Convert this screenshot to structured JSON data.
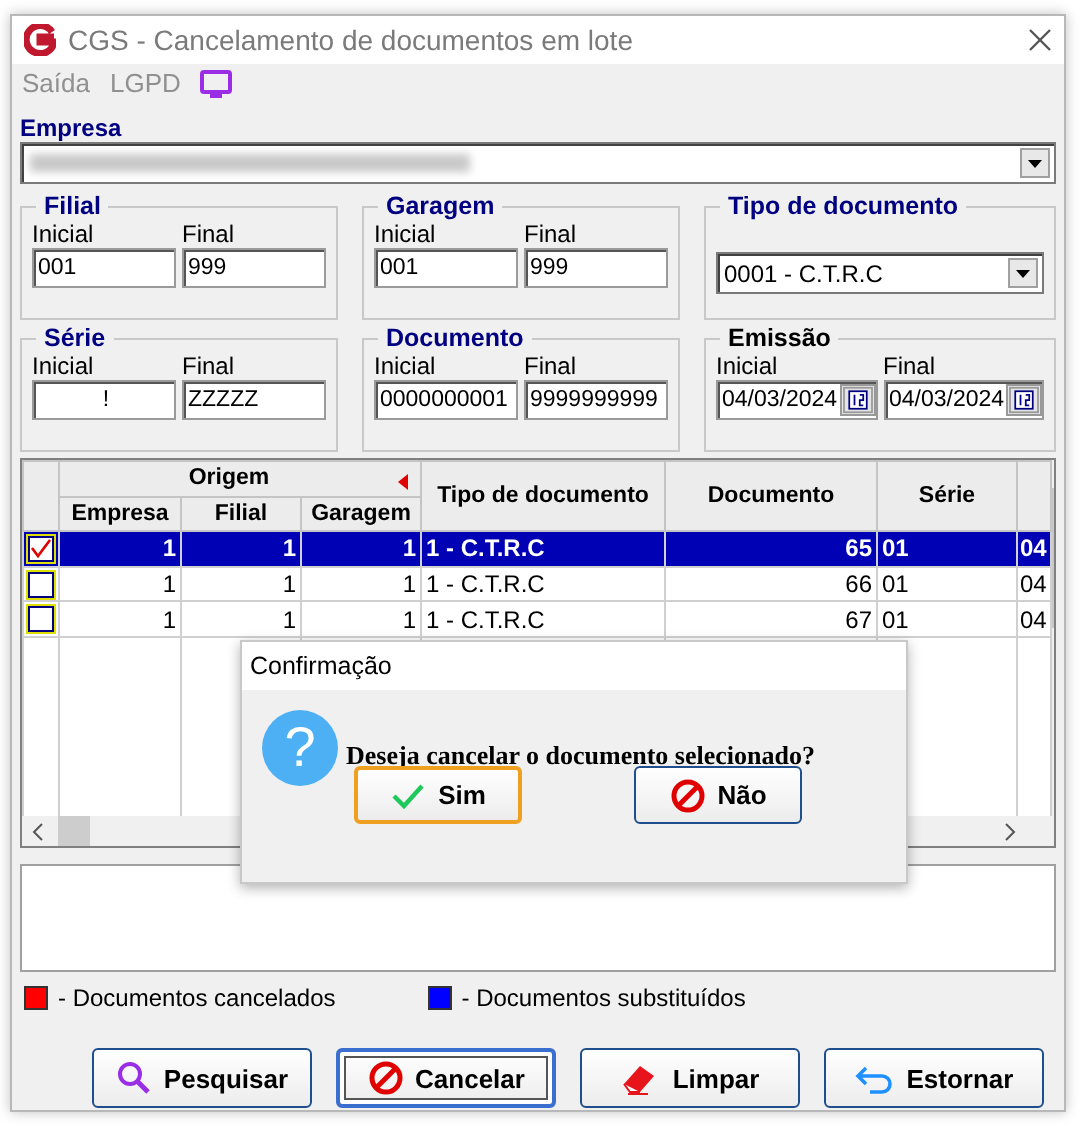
{
  "window": {
    "title": "CGS - Cancelamento de documentos em lote"
  },
  "menu": [
    {
      "label": "Saída"
    },
    {
      "label": "LGPD"
    }
  ],
  "empresa": {
    "label": "Empresa"
  },
  "groups": [
    {
      "title": "Filial",
      "kind": "range",
      "required": true,
      "initial_label": "Inicial",
      "initial": "001",
      "final_label": "Final",
      "final": "999"
    },
    {
      "title": "Garagem",
      "kind": "range",
      "required": true,
      "initial_label": "Inicial",
      "initial": "001",
      "final_label": "Final",
      "final": "999"
    },
    {
      "title": "Tipo de documento",
      "kind": "select",
      "required": true,
      "value": "0001 - C.T.R.C"
    },
    {
      "title": "Série",
      "kind": "range",
      "required": true,
      "initial_label": "Inicial",
      "initial": "!",
      "final_label": "Final",
      "final": "ZZZZZ"
    },
    {
      "title": "Documento",
      "kind": "range",
      "required": true,
      "initial_label": "Inicial",
      "initial": "0000000001",
      "final_label": "Final",
      "final": "9999999999"
    },
    {
      "title": "Emissão",
      "kind": "date_range",
      "required": false,
      "initial_label": "Inicial",
      "initial": "04/03/2024",
      "final_label": "Final",
      "final": "04/03/2024"
    }
  ],
  "grid": {
    "group_header": "Origem",
    "columns": [
      "Empresa",
      "Filial",
      "Garagem",
      "Tipo de documento",
      "Documento",
      "Série"
    ],
    "rows": [
      {
        "checked": true,
        "selected": true,
        "cells": [
          "1",
          "1",
          "1",
          "1 - C.T.R.C",
          "65",
          "01",
          "04"
        ]
      },
      {
        "checked": false,
        "selected": false,
        "cells": [
          "1",
          "1",
          "1",
          "1 - C.T.R.C",
          "66",
          "01",
          "04"
        ]
      },
      {
        "checked": false,
        "selected": false,
        "cells": [
          "1",
          "1",
          "1",
          "1 - C.T.R.C",
          "67",
          "01",
          "04"
        ]
      }
    ]
  },
  "dialog": {
    "title": "Confirmação",
    "icon": "?",
    "message": "Deseja cancelar o documento selecionado?",
    "buttons": [
      {
        "label": "Sim",
        "kind": "yes",
        "default": true
      },
      {
        "label": "Não",
        "kind": "no",
        "default": false
      }
    ]
  },
  "legend": [
    {
      "label": "- Documentos cancelados",
      "color": "#ff0000"
    },
    {
      "label": "- Documentos substituídos",
      "color": "#0000ff"
    }
  ],
  "buttons": [
    {
      "label": "Pesquisar",
      "kind": "search",
      "focused": false
    },
    {
      "label": "Cancelar",
      "kind": "cancel",
      "focused": true
    },
    {
      "label": "Limpar",
      "kind": "clear",
      "focused": false
    },
    {
      "label": "Estornar",
      "kind": "undo",
      "focused": false
    }
  ]
}
